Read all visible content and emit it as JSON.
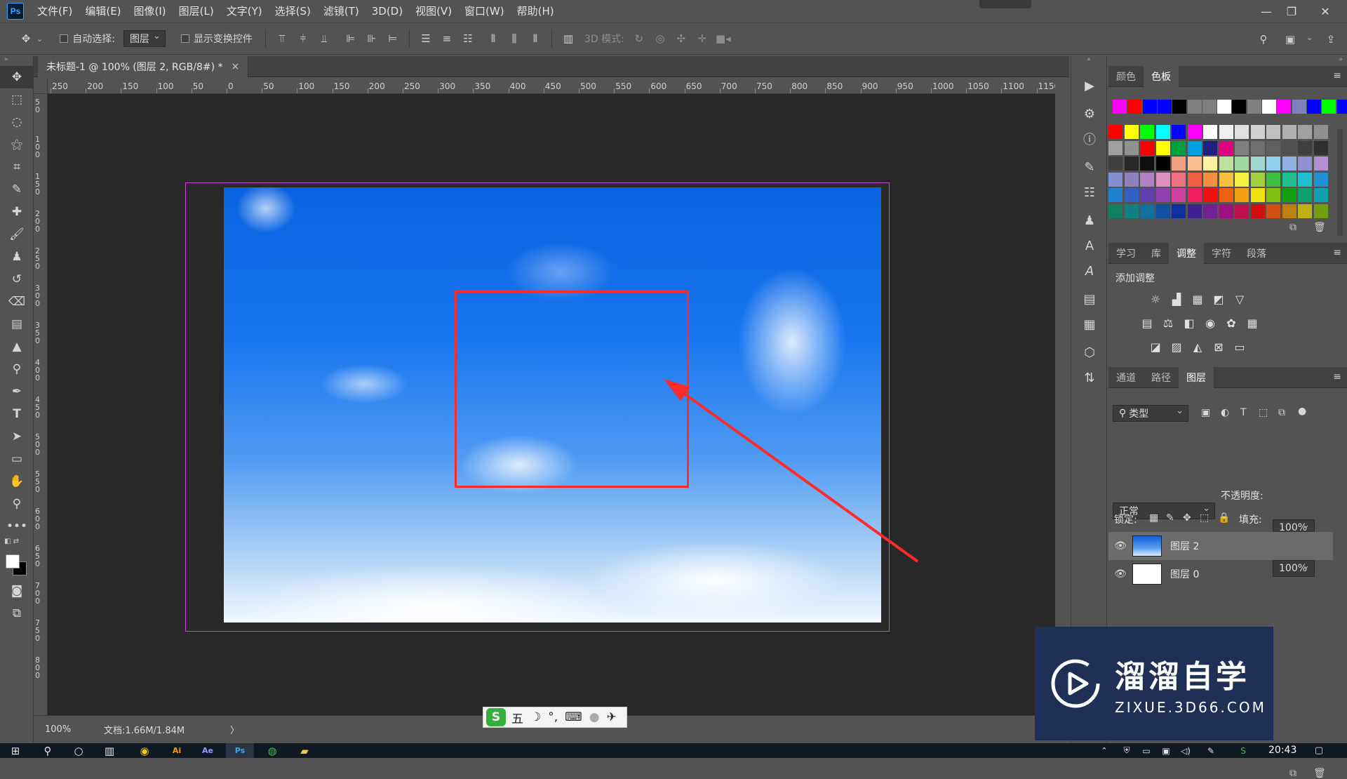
{
  "menubar": {
    "logo": "Ps",
    "items": [
      "文件(F)",
      "编辑(E)",
      "图像(I)",
      "图层(L)",
      "文字(Y)",
      "选择(S)",
      "滤镜(T)",
      "3D(D)",
      "视图(V)",
      "窗口(W)",
      "帮助(H)"
    ],
    "window_controls": [
      "—",
      "❐",
      "✕"
    ]
  },
  "options": {
    "auto_select_label": "自动选择:",
    "auto_select_target": "图层",
    "show_transform_label": "显示变换控件",
    "mode_3d_label": "3D 模式:"
  },
  "document": {
    "tab_title": "未标题-1 @ 100% (图层 2, RGB/8#) *",
    "tab_close": "×",
    "ruler_top": [
      "250",
      "200",
      "150",
      "100",
      "50",
      "0",
      "50",
      "100",
      "150",
      "200",
      "250",
      "300",
      "350",
      "400",
      "450",
      "500",
      "550",
      "600",
      "650",
      "700",
      "750",
      "800",
      "850",
      "900",
      "950",
      "1000",
      "1050",
      "1100",
      "1150"
    ],
    "ruler_left": [
      "50",
      "100",
      "150",
      "200",
      "250",
      "300",
      "350",
      "400",
      "450",
      "500",
      "550",
      "600",
      "650",
      "700",
      "750",
      "800"
    ],
    "zoom": "100%",
    "doc_info": "文档:1.66M/1.84M",
    "status_arrow": "〉"
  },
  "panels": {
    "color_tabs": [
      "颜色",
      "色板"
    ],
    "adjust_tabs": [
      "学习",
      "库",
      "调整",
      "字符",
      "段落"
    ],
    "add_adjust_label": "添加调整",
    "layer_tabs": [
      "通道",
      "路径",
      "图层"
    ],
    "filter_kind": "类型",
    "blend_mode": "正常",
    "opacity_label": "不透明度:",
    "opacity_value": "100%",
    "lock_label": "锁定:",
    "fill_label": "填充:",
    "fill_value": "100%",
    "layers": [
      {
        "name": "图层 2"
      },
      {
        "name": "图层 0"
      }
    ]
  },
  "swatches": {
    "recent": [
      "#ff00ff",
      "#ff0000",
      "#0000ff",
      "#0000ff",
      "#000000",
      "#808080",
      "#808080",
      "#ffffff",
      "#000000",
      "#808080",
      "#ffffff",
      "#ff00ff",
      "#8080c0",
      "#0000ff",
      "#00ff00",
      "#0000ff"
    ],
    "grid": [
      [
        "#ff0000",
        "#ffff00",
        "#00ff00",
        "#00ffff",
        "#0000ff",
        "#ff00ff",
        "#ffffff",
        "#f0f0f0",
        "#e0e0e0",
        "#d0d0d0",
        "#c0c0c0",
        "#b0b0b0",
        "#a0a0a0",
        "#909090"
      ],
      [
        "#a0a0a0",
        "#909090",
        "#ff0000",
        "#ffff00",
        "#00a040",
        "#00a0e0",
        "#202080",
        "#e00080",
        "#808080",
        "#707070",
        "#606060",
        "#505050",
        "#404040",
        "#303030"
      ],
      [
        "#404040",
        "#282828",
        "#101010",
        "#000000",
        "#f0a080",
        "#f8c090",
        "#fff0a0",
        "#c0e0a0",
        "#a0d8a0",
        "#a0d8d0",
        "#90d0f0",
        "#90b0e0",
        "#9090d0",
        "#b090d0"
      ],
      [
        "#8090d0",
        "#9080c0",
        "#b080c0",
        "#e090c0",
        "#f07080",
        "#f06040",
        "#f09040",
        "#f8c040",
        "#f8f040",
        "#a0d040",
        "#40c040",
        "#20c090",
        "#20c0d0",
        "#2090d0"
      ],
      [
        "#2080d0",
        "#3060c0",
        "#6040b0",
        "#9040b0",
        "#d040a0",
        "#f02060",
        "#f01010",
        "#f06010",
        "#f0a010",
        "#f0e010",
        "#80c010",
        "#10a010",
        "#10a070",
        "#10a0b0"
      ],
      [
        "#108060",
        "#108080",
        "#1070a0",
        "#1050a0",
        "#1030a0",
        "#402090",
        "#702090",
        "#a01080",
        "#c01050",
        "#d01010",
        "#d05010",
        "#c08010",
        "#c0b010",
        "#70a010"
      ]
    ]
  },
  "taskbar": {
    "time": "20:43"
  },
  "ime": {
    "logo": "S",
    "mode": "五",
    "moon": "☽",
    "punct": "°,",
    "keyboard": "⌨",
    "user": "●",
    "tools": "✈"
  },
  "watermark": {
    "title": "溜溜自学",
    "url": "ZIXUE.3D66.COM"
  }
}
